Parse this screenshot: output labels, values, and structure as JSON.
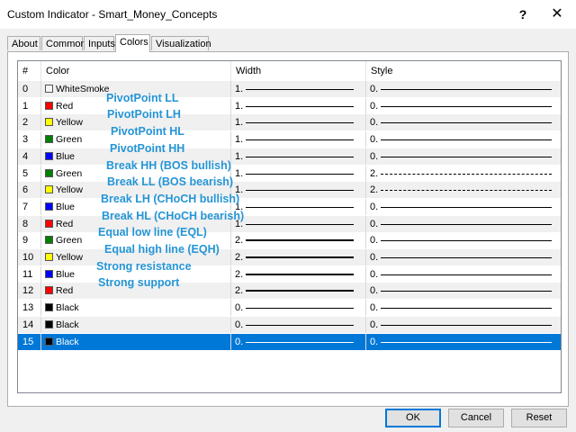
{
  "window": {
    "title": "Custom Indicator - Smart_Money_Concepts",
    "help_glyph": "?",
    "close_glyph": "✕"
  },
  "tabs": [
    {
      "label": "About"
    },
    {
      "label": "Common"
    },
    {
      "label": "Inputs"
    },
    {
      "label": "Colors",
      "active": true
    },
    {
      "label": "Visualization"
    }
  ],
  "table": {
    "headers": {
      "num": "#",
      "color": "Color",
      "width": "Width",
      "style": "Style"
    },
    "rows": [
      {
        "num": "0",
        "color": "WhiteSmoke",
        "hex": "#f5f5f5",
        "width": "1.",
        "style": "0.",
        "line_width": 1,
        "style_kind": "solid",
        "annotation": ""
      },
      {
        "num": "1",
        "color": "Red",
        "hex": "#ff0000",
        "width": "1.",
        "style": "0.",
        "line_width": 1,
        "style_kind": "solid",
        "annotation": "PivotPoint LL"
      },
      {
        "num": "2",
        "color": "Yellow",
        "hex": "#ffff00",
        "width": "1.",
        "style": "0.",
        "line_width": 1,
        "style_kind": "solid",
        "annotation": "PivotPoint LH"
      },
      {
        "num": "3",
        "color": "Green",
        "hex": "#008000",
        "width": "1.",
        "style": "0.",
        "line_width": 1,
        "style_kind": "solid",
        "annotation": "PivotPoint HL"
      },
      {
        "num": "4",
        "color": "Blue",
        "hex": "#0000ff",
        "width": "1.",
        "style": "0.",
        "line_width": 1,
        "style_kind": "solid",
        "annotation": "PivotPoint HH"
      },
      {
        "num": "5",
        "color": "Green",
        "hex": "#008000",
        "width": "1.",
        "style": "2.",
        "line_width": 1,
        "style_kind": "dashed",
        "annotation": "Break HH (BOS bullish)"
      },
      {
        "num": "6",
        "color": "Yellow",
        "hex": "#ffff00",
        "width": "1.",
        "style": "2.",
        "line_width": 1,
        "style_kind": "dashed",
        "annotation": "Break LL (BOS bearish)"
      },
      {
        "num": "7",
        "color": "Blue",
        "hex": "#0000ff",
        "width": "1.",
        "style": "0.",
        "line_width": 1,
        "style_kind": "solid",
        "annotation": "Break LH (CHoCH bullish)"
      },
      {
        "num": "8",
        "color": "Red",
        "hex": "#ff0000",
        "width": "1.",
        "style": "0.",
        "line_width": 1,
        "style_kind": "solid",
        "annotation": "Break HL (CHoCH bearish)"
      },
      {
        "num": "9",
        "color": "Green",
        "hex": "#008000",
        "width": "2.",
        "style": "0.",
        "line_width": 2,
        "style_kind": "solid",
        "annotation": "Equal low line (EQL)"
      },
      {
        "num": "10",
        "color": "Yellow",
        "hex": "#ffff00",
        "width": "2.",
        "style": "0.",
        "line_width": 2,
        "style_kind": "solid",
        "annotation": "Equal high line (EQH)"
      },
      {
        "num": "11",
        "color": "Blue",
        "hex": "#0000ff",
        "width": "2.",
        "style": "0.",
        "line_width": 2,
        "style_kind": "solid",
        "annotation": "Strong resistance"
      },
      {
        "num": "12",
        "color": "Red",
        "hex": "#ff0000",
        "width": "2.",
        "style": "0.",
        "line_width": 2,
        "style_kind": "solid",
        "annotation": "Strong support"
      },
      {
        "num": "13",
        "color": "Black",
        "hex": "#000000",
        "width": "0.",
        "style": "0.",
        "line_width": 1,
        "style_kind": "solid",
        "annotation": ""
      },
      {
        "num": "14",
        "color": "Black",
        "hex": "#000000",
        "width": "0.",
        "style": "0.",
        "line_width": 1,
        "style_kind": "solid",
        "annotation": ""
      },
      {
        "num": "15",
        "color": "Black",
        "hex": "#000000",
        "width": "0.",
        "style": "0.",
        "line_width": 1,
        "style_kind": "solid",
        "annotation": "",
        "selected": true
      }
    ]
  },
  "buttons": {
    "ok": "OK",
    "cancel": "Cancel",
    "reset": "Reset"
  },
  "colors": {
    "annotation": "#2595d6",
    "selection": "#0078d7"
  }
}
